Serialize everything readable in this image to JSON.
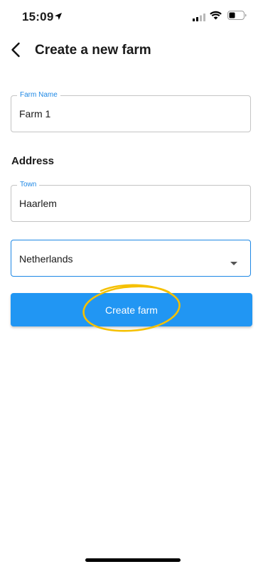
{
  "status_bar": {
    "time": "15:09",
    "icons": [
      "location-arrow-icon",
      "cellular-signal-icon",
      "wifi-icon",
      "battery-icon"
    ]
  },
  "header": {
    "title": "Create a new farm",
    "back_icon": "chevron-left-icon"
  },
  "form": {
    "farm_name": {
      "label": "Farm Name",
      "value": "Farm 1"
    },
    "address_heading": "Address",
    "town": {
      "label": "Town",
      "value": "Haarlem"
    },
    "country": {
      "value": "Netherlands",
      "icon": "caret-down-icon"
    },
    "submit_label": "Create farm"
  },
  "colors": {
    "accent": "#2196f3",
    "label": "#1e88e5",
    "annotation": "#f5c000"
  }
}
